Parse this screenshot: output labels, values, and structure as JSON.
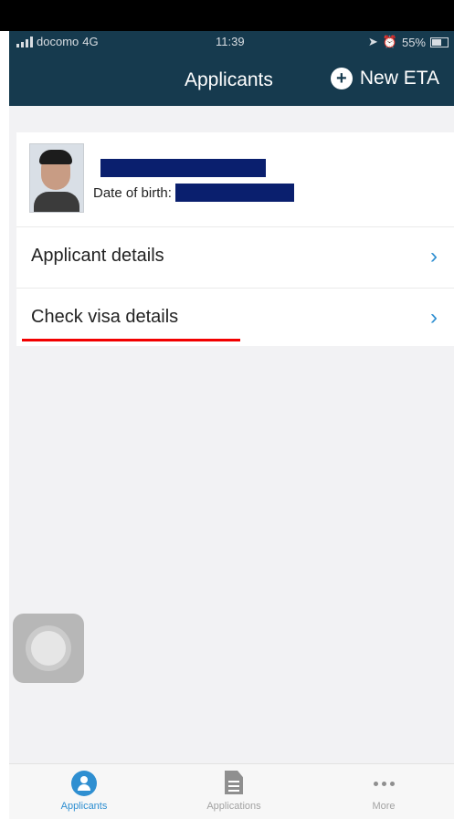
{
  "status_bar": {
    "carrier": "docomo",
    "network": "4G",
    "time": "11:39",
    "battery": "55%",
    "battery_level": 0.55
  },
  "nav": {
    "title": "Applicants",
    "new_eta_label": "New ETA",
    "new_eta_icon": "plus-circle-icon"
  },
  "applicant": {
    "dob_label": "Date of birth:"
  },
  "menu": [
    {
      "label": "Applicant details",
      "icon": "chevron-right-icon"
    },
    {
      "label": "Check visa details",
      "icon": "chevron-right-icon"
    }
  ],
  "tabbar": {
    "tabs": [
      {
        "label": "Applicants",
        "icon": "person-icon",
        "active": true
      },
      {
        "label": "Applications",
        "icon": "document-icon",
        "active": false
      },
      {
        "label": "More",
        "icon": "more-icon",
        "active": false
      }
    ]
  },
  "colors": {
    "header": "#163a4e",
    "accent": "#2f8fd1",
    "highlight": "#f20000",
    "redaction": "#0a1f6e"
  }
}
